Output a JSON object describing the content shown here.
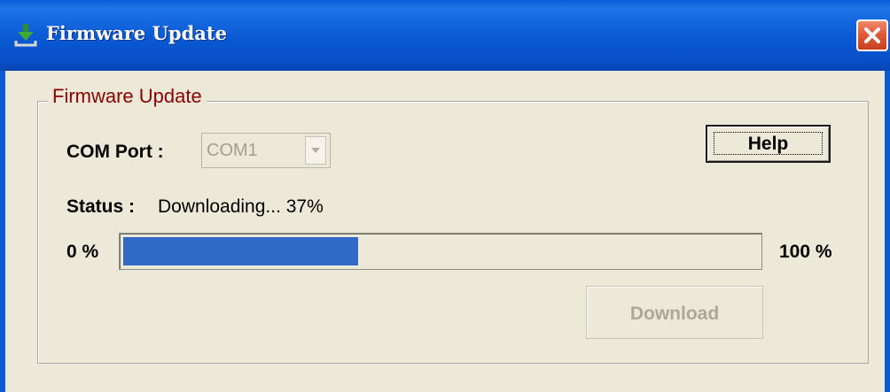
{
  "window": {
    "title": "Firmware Update",
    "icon": "download-arrow-icon",
    "close_icon": "close-icon"
  },
  "group": {
    "title": "Firmware Update"
  },
  "com_port": {
    "label": "COM Port :",
    "value": "COM1",
    "enabled": false
  },
  "help_button": {
    "label": "Help"
  },
  "status": {
    "label": "Status :",
    "text": "Downloading... 37%"
  },
  "progress": {
    "min_label": "0 %",
    "max_label": "100 %",
    "value": 0.37
  },
  "download_button": {
    "label": "Download",
    "enabled": false
  },
  "colors": {
    "titlebar": "#0b5ad6",
    "group_title": "#8b0000",
    "progress_fill": "#3169c6",
    "close_button": "#e05a3a"
  }
}
